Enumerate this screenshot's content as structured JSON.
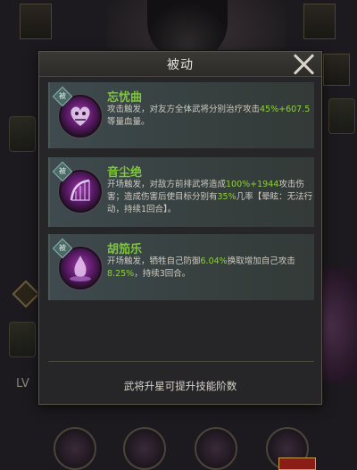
{
  "modal": {
    "title": "被动",
    "footer_note": "武将升星可提升技能阶数"
  },
  "skills": [
    {
      "name": "忘忧曲",
      "badge": "被",
      "desc_parts": [
        "攻击触发，对友方全体武将分别治疗攻击",
        "45%+607.5",
        "等量血量。"
      ],
      "icon": "heart-skull-icon"
    },
    {
      "name": "音尘绝",
      "badge": "被",
      "desc_parts": [
        "开场触发，对敌方前排武将造成",
        "100%+1944",
        "攻击伤害；造成伤害后使目标分别有",
        "35%",
        "几率【晕眩：无法行动，持续1回合】。"
      ],
      "icon": "harp-icon"
    },
    {
      "name": "胡笳乐",
      "badge": "被",
      "desc_parts": [
        "开场触发，牺牲自己防御",
        "6.04%",
        "换取增加自己攻击",
        "8.25%",
        "，持续3回合。"
      ],
      "icon": "flame-orb-icon"
    }
  ],
  "background": {
    "level_label": "LV"
  },
  "colors": {
    "highlight": "#8ed03a",
    "skill_name": "#7ec83a",
    "modal_bg": "#262528",
    "card_bg": "#3e4a4e"
  }
}
